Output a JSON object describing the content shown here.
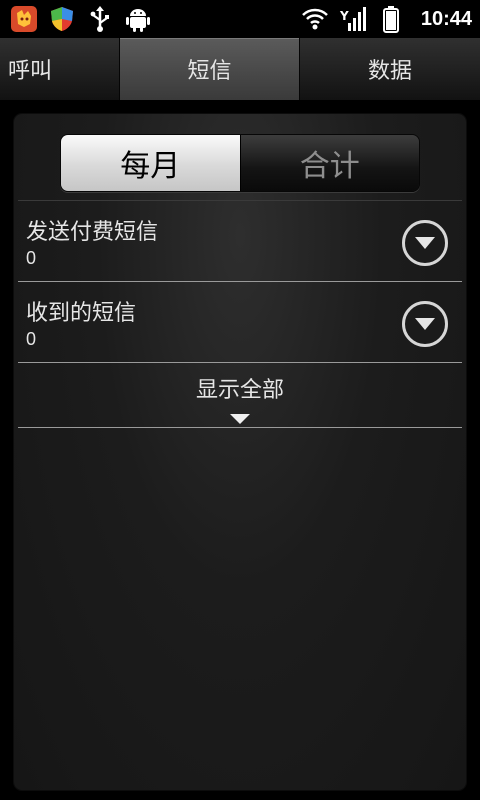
{
  "status_bar": {
    "time": "10:44",
    "icons": [
      "app-fox-icon",
      "shield-icon",
      "usb-icon",
      "android-icon",
      "wifi-icon",
      "signal-icon",
      "battery-icon"
    ]
  },
  "tabs": [
    {
      "label": "呼叫"
    },
    {
      "label": "短信",
      "selected": true
    },
    {
      "label": "数据"
    }
  ],
  "segment": {
    "active": "每月",
    "inactive": "合计"
  },
  "rows": [
    {
      "title": "发送付费短信",
      "value": "0"
    },
    {
      "title": "收到的短信",
      "value": "0"
    }
  ],
  "show_all": {
    "label": "显示全部"
  },
  "colors": {
    "background": "#000000",
    "panel": "#1c1c1c",
    "text": "#e6e6e6",
    "selected_tab": "#4a4a4a"
  }
}
